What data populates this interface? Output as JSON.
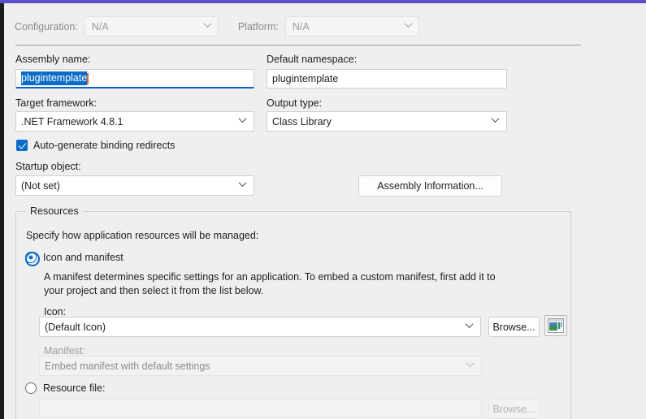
{
  "window": {
    "accent_color": "#5c4ecb",
    "background_color": "#efefef"
  },
  "config_bar": {
    "configuration_label": "Configuration:",
    "configuration_value": "N/A",
    "platform_label": "Platform:",
    "platform_value": "N/A"
  },
  "general": {
    "assembly_name_label": "Assembly name:",
    "assembly_name_value": "plugintemplate",
    "default_namespace_label": "Default namespace:",
    "default_namespace_value": "plugintemplate",
    "target_framework_label": "Target framework:",
    "target_framework_value": ".NET Framework 4.8.1",
    "output_type_label": "Output type:",
    "output_type_value": "Class Library",
    "auto_generate_label": "Auto-generate binding redirects",
    "auto_generate_checked": true,
    "startup_object_label": "Startup object:",
    "startup_object_value": "(Not set)",
    "assembly_information_label": "Assembly Information..."
  },
  "resources": {
    "group_title": "Resources",
    "description": "Specify how application resources will be managed:",
    "icon_manifest_option_label": "Icon and manifest",
    "icon_manifest_selected": true,
    "manifest_help_line1": "A manifest determines specific settings for an application. To embed a custom manifest, first add it to",
    "manifest_help_line2": "your project and then select it from the list below.",
    "icon_label": "Icon:",
    "icon_value": "(Default Icon)",
    "icon_browse_label": "Browse...",
    "icon_preview_name": "default-application-icon",
    "manifest_label": "Manifest:",
    "manifest_value": "Embed manifest with default settings",
    "manifest_disabled": true,
    "resource_file_option_label": "Resource file:",
    "resource_file_selected": false,
    "resource_file_value": "",
    "resource_file_browse_label": "Browse..."
  }
}
